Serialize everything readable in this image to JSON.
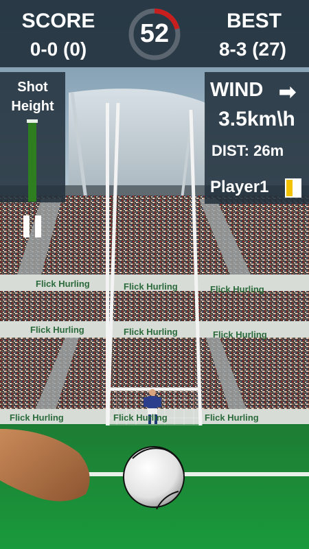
{
  "hud": {
    "score_label": "SCORE",
    "score_value": "0-0 (0)",
    "timer": "52",
    "best_label": "BEST",
    "best_value": "8-3 (27)"
  },
  "shot": {
    "label_line1": "Shot",
    "label_line2": "Height"
  },
  "wind": {
    "label": "WIND",
    "arrow": "➡",
    "speed": "3.5km\\h",
    "distance": "DIST: 26m",
    "player": "Player1"
  },
  "banners": {
    "text": "Flick Hurling"
  },
  "colors": {
    "pitch": "#1f8a3a",
    "hud_bg": "#23323e",
    "timer_accent": "#c81e1e",
    "banner_text": "#2b6a3b",
    "team_gold": "#f2c200"
  },
  "icons": {
    "pause": "pause-icon",
    "wind_arrow": "arrow-right-icon"
  }
}
